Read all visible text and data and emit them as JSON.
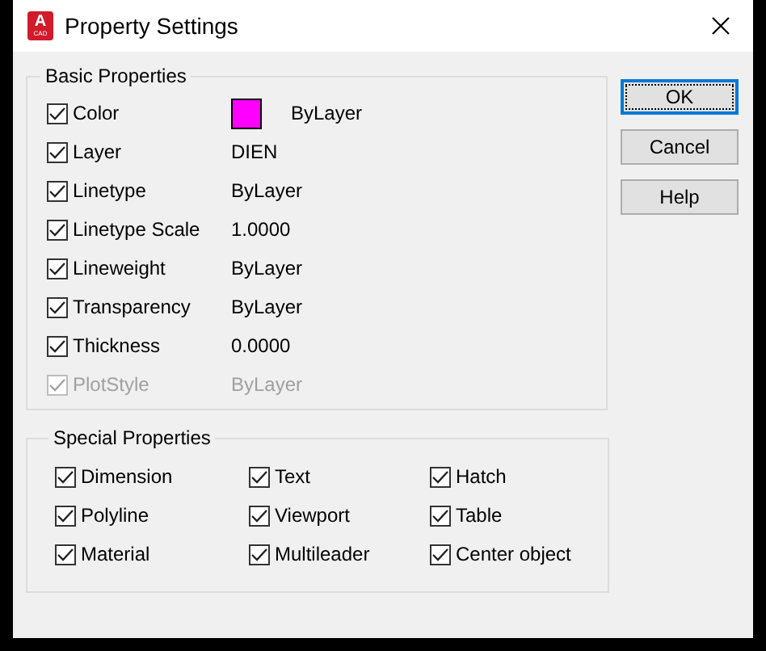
{
  "window": {
    "title": "Property Settings",
    "app_badge": "A",
    "app_badge_sub": "CAD"
  },
  "basic_properties": {
    "title": "Basic Properties",
    "rows": [
      {
        "kind": "color",
        "label": "Color",
        "checked": true,
        "disabled": false,
        "color": "#ff00ff",
        "value": "ByLayer"
      },
      {
        "kind": "text",
        "label": "Layer",
        "checked": true,
        "disabled": false,
        "value": "DIEN"
      },
      {
        "kind": "text",
        "label": "Linetype",
        "checked": true,
        "disabled": false,
        "value": "ByLayer"
      },
      {
        "kind": "text",
        "label": "Linetype Scale",
        "checked": true,
        "disabled": false,
        "value": "1.0000"
      },
      {
        "kind": "text",
        "label": "Lineweight",
        "checked": true,
        "disabled": false,
        "value": "ByLayer"
      },
      {
        "kind": "text",
        "label": "Transparency",
        "checked": true,
        "disabled": false,
        "value": "ByLayer"
      },
      {
        "kind": "text",
        "label": "Thickness",
        "checked": true,
        "disabled": false,
        "value": "0.0000"
      },
      {
        "kind": "text",
        "label": "PlotStyle",
        "checked": true,
        "disabled": true,
        "value": "ByLayer"
      }
    ]
  },
  "special_properties": {
    "title": "Special Properties",
    "items": [
      {
        "label": "Dimension",
        "checked": true
      },
      {
        "label": "Text",
        "checked": true
      },
      {
        "label": "Hatch",
        "checked": true
      },
      {
        "label": "Polyline",
        "checked": true
      },
      {
        "label": "Viewport",
        "checked": true
      },
      {
        "label": "Table",
        "checked": true
      },
      {
        "label": "Material",
        "checked": true
      },
      {
        "label": "Multileader",
        "checked": true
      },
      {
        "label": "Center object",
        "checked": true
      }
    ]
  },
  "buttons": [
    {
      "label": "OK",
      "default": true
    },
    {
      "label": "Cancel",
      "default": false
    },
    {
      "label": "Help",
      "default": false
    }
  ]
}
